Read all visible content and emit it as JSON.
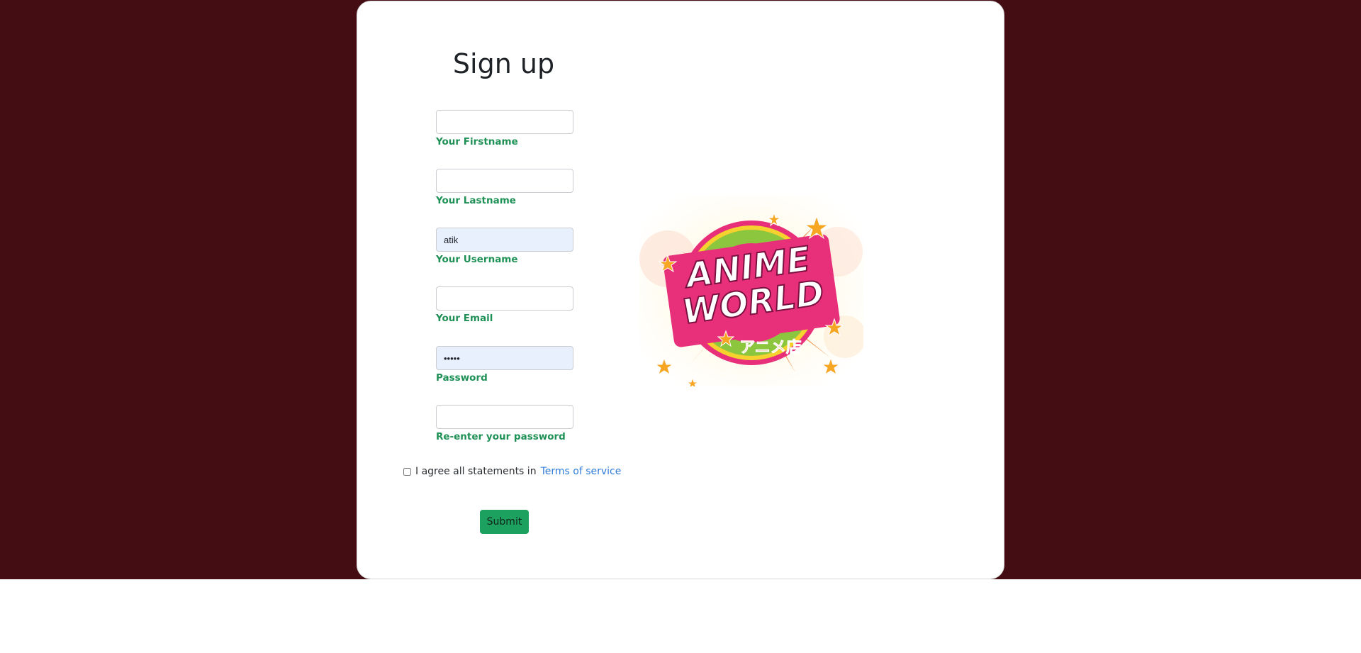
{
  "form": {
    "title": "Sign up",
    "fields": [
      {
        "label": "Your Firstname",
        "value": "",
        "type": "text"
      },
      {
        "label": "Your Lastname",
        "value": "",
        "type": "text"
      },
      {
        "label": "Your Username",
        "value": "atik",
        "type": "text"
      },
      {
        "label": "Your Email",
        "value": "",
        "type": "email"
      },
      {
        "label": "Password",
        "value": "•••••",
        "type": "password"
      },
      {
        "label": "Re-enter your password",
        "value": "",
        "type": "password"
      }
    ],
    "agree_text": "I agree all statements in",
    "terms_link": "Terms of service",
    "submit_label": "Submit"
  },
  "logo": {
    "line1": "ANIME",
    "line2": "WORLD",
    "subtitle": "アニメ店"
  },
  "colors": {
    "background": "#430d13",
    "label": "#1f9156",
    "button": "#1da15f",
    "link": "#2f7cd8"
  }
}
